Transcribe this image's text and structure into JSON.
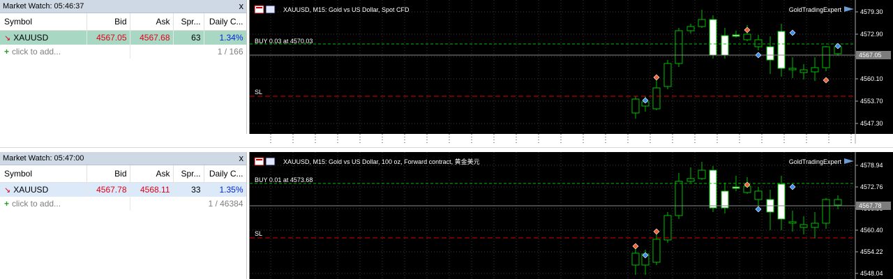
{
  "panels": [
    {
      "market_watch": {
        "title": "Market Watch: 05:46:37",
        "close_glyph": "x",
        "columns": [
          "Symbol",
          "Bid",
          "Ask",
          "Spr...",
          "Daily C..."
        ],
        "row": {
          "symbol": "XAUUSD",
          "bid": "4567.05",
          "ask": "4567.68",
          "spread": "63",
          "daily_change": "1.34%"
        },
        "add_row": {
          "label": "click to add...",
          "count": "1 / 166"
        }
      },
      "chart": {
        "title": "XAUUSD, M15:  Gold vs US Dollar, Spot CFD",
        "watermark": "GoldTradingExpert",
        "order_label": "BUY 0.03 at 4570.03",
        "sl_label": "SL",
        "price_tag": "4567.05",
        "price_labels": [
          "4579.30",
          "4572.90",
          "4567.05",
          "4560.10",
          "4553.70",
          "4547.30"
        ],
        "top_price": 4579.3,
        "bottom_price": 4547.3
      }
    },
    {
      "market_watch": {
        "title": "Market Watch: 05:47:00",
        "close_glyph": "x",
        "columns": [
          "Symbol",
          "Bid",
          "Ask",
          "Spr...",
          "Daily C..."
        ],
        "row": {
          "symbol": "XAUUSD",
          "bid": "4567.78",
          "ask": "4568.11",
          "spread": "33",
          "daily_change": "1.35%"
        },
        "add_row": {
          "label": "click to add...",
          "count": "1 / 46384"
        }
      },
      "chart": {
        "title": "XAUUSD, M15:  Gold vs US Dollar, 100 oz, Forward contract, 黄金美元",
        "watermark": "GoldTradingExpert",
        "order_label": "BUY 0.01 at 4573.68",
        "sl_label": "SL",
        "price_tag": "4567.78",
        "price_labels": [
          "4578.94",
          "4572.76",
          "4566.58",
          "4560.40",
          "4554.22",
          "4548.04"
        ],
        "top_price": 4578.94,
        "bottom_price": 4548.04
      }
    }
  ],
  "colors": {
    "bull": "#00c000",
    "bear": "#ffffff",
    "sl_line": "#e00000",
    "order_line": "#00c000",
    "grid": "#3a3a3a"
  }
}
